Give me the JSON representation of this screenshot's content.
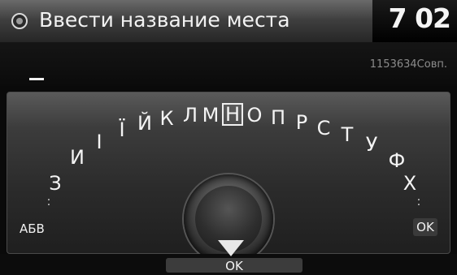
{
  "header": {
    "title": "Ввести название места",
    "clock": "7 02",
    "icon": "navigation-icon"
  },
  "entry": {
    "cursor": "_",
    "match_count": "1153634Совп."
  },
  "keyboard": {
    "letters": [
      "З",
      "И",
      "І",
      "Ї",
      "Й",
      "К",
      "Л",
      "М",
      "Н",
      "О",
      "П",
      "Р",
      "С",
      "Т",
      "У",
      "Ф",
      "Х"
    ],
    "selected": "Н",
    "left_button": "АБВ",
    "right_button": "OK"
  },
  "bottom": {
    "ok_label": "OK",
    "arrow_icon": "down-arrow-icon"
  }
}
